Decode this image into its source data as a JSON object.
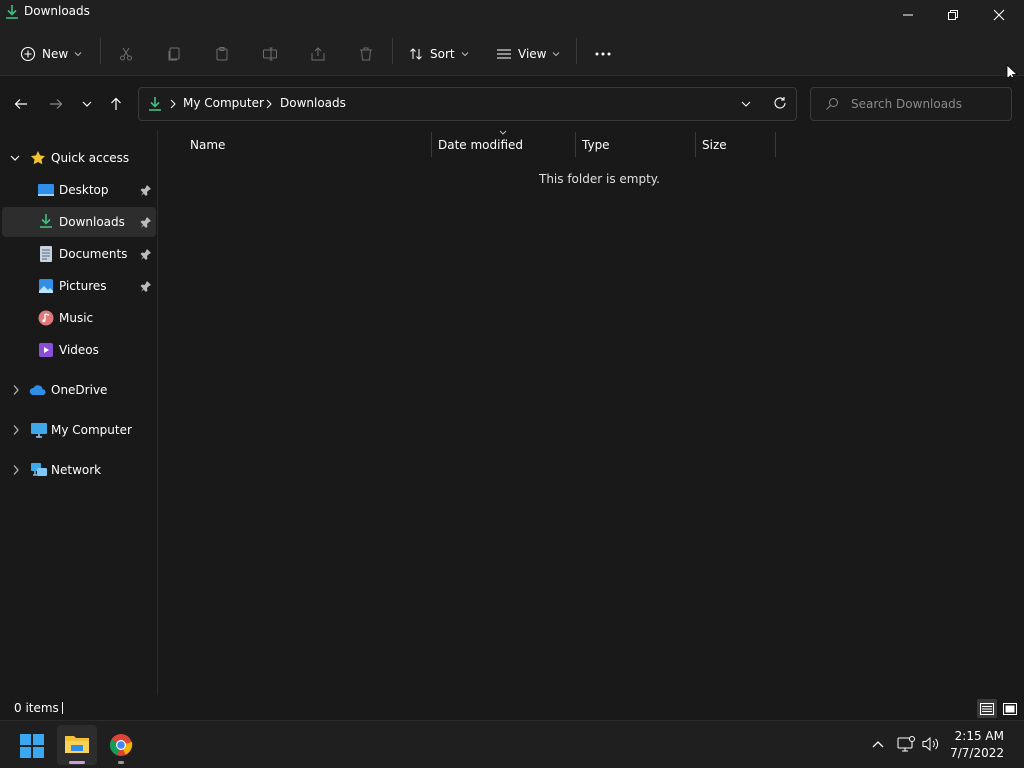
{
  "window": {
    "title": "Downloads"
  },
  "toolbar": {
    "new_label": "New",
    "sort_label": "Sort",
    "view_label": "View"
  },
  "address": {
    "crumbs": [
      "My Computer",
      "Downloads"
    ]
  },
  "search": {
    "placeholder": "Search Downloads"
  },
  "sidebar": {
    "items": [
      {
        "label": "Quick access"
      },
      {
        "label": "Desktop"
      },
      {
        "label": "Downloads"
      },
      {
        "label": "Documents"
      },
      {
        "label": "Pictures"
      },
      {
        "label": "Music"
      },
      {
        "label": "Videos"
      },
      {
        "label": "OneDrive"
      },
      {
        "label": "My Computer"
      },
      {
        "label": "Network"
      }
    ]
  },
  "columns": [
    "Name",
    "Date modified",
    "Type",
    "Size"
  ],
  "content": {
    "empty_message": "This folder is empty."
  },
  "status": {
    "item_count": "0 items"
  },
  "taskbar": {
    "time": "2:15 AM",
    "date": "7/7/2022"
  },
  "colors": {
    "accent_green": "#3fbf7f",
    "folder_yellow": "#f3c233",
    "onedrive_blue": "#2f8fe8"
  }
}
